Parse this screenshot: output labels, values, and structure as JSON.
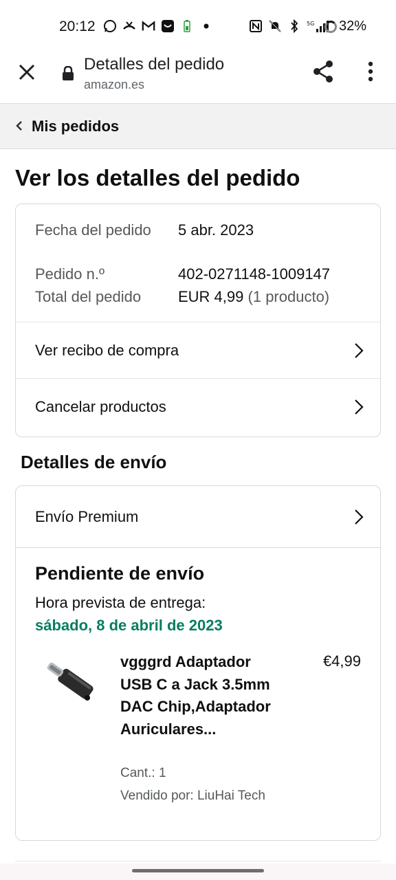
{
  "status_bar": {
    "time": "20:12",
    "left_icons": [
      "whatsapp-icon",
      "missed-call-icon",
      "gmail-icon",
      "app-icon",
      "battery-saver-icon",
      "dot-icon"
    ],
    "right_icons": [
      "nfc-icon",
      "mute-icon",
      "bluetooth-icon",
      "5g-signal-icon"
    ],
    "battery": "32%"
  },
  "browser": {
    "title": "Detalles del pedido",
    "url": "amazon.es",
    "icons": [
      "close-icon",
      "lock-icon",
      "share-icon",
      "more-vert-icon"
    ]
  },
  "breadcrumb": {
    "label": "Mis pedidos"
  },
  "page_title": "Ver los detalles del pedido",
  "summary": {
    "date_label": "Fecha del pedido",
    "date_value": "5 abr. 2023",
    "order_label": "Pedido n.º",
    "order_value": "402-0271148-1009147",
    "total_label": "Total del pedido",
    "total_value": "EUR 4,99",
    "total_count": "(1 producto)"
  },
  "links": {
    "receipt": "Ver recibo de compra",
    "cancel": "Cancelar productos"
  },
  "shipping": {
    "section_title": "Detalles de envío",
    "method": "Envío Premium",
    "status": "Pendiente de envío",
    "eta_label": "Hora prevista de entrega:",
    "eta_date": "sábado, 8 de abril de 2023"
  },
  "product": {
    "title": "vgggrd Adaptador USB C a Jack 3.5mm DAC Chip,Adaptador Auriculares...",
    "price": "€4,99",
    "qty": "Cant.: 1",
    "seller": "Vendido por: LiuHai Tech"
  },
  "colors": {
    "eta_green": "#067d62",
    "breadcrumb_bg": "#f2f2f2",
    "border": "#d5d9d9"
  }
}
